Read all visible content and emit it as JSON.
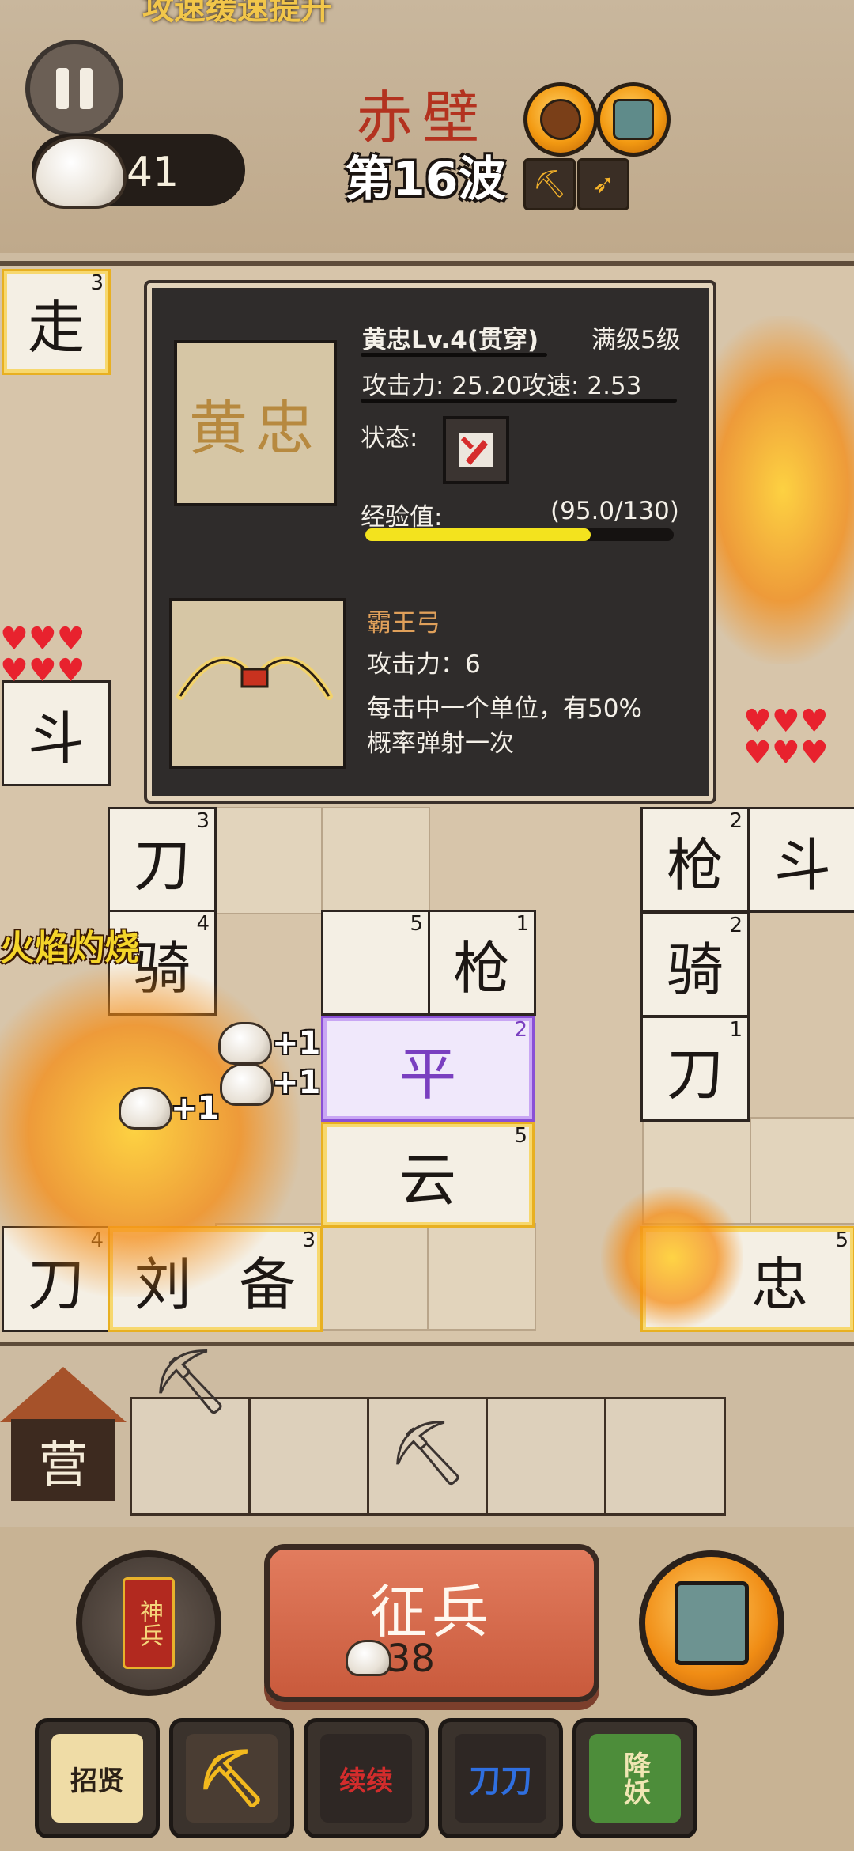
{
  "header": {
    "banner_text": "攻速缓速提升",
    "currency": "41",
    "stage": "赤壁",
    "wave": "第16波"
  },
  "board": {
    "float_texts": [
      "+1",
      "+1",
      "+1"
    ],
    "burn_text": "火焰灼烧",
    "cells": [
      {
        "char": "走",
        "lv": "3"
      },
      {
        "char": "斗",
        "lv": ""
      },
      {
        "char": "斗",
        "lv": ""
      },
      {
        "char": "刀",
        "lv": "3"
      },
      {
        "char": "枪",
        "lv": "2"
      },
      {
        "char": "骑",
        "lv": "2"
      },
      {
        "char": "刀",
        "lv": "1"
      },
      {
        "char": "枪",
        "lv": "1"
      },
      {
        "char": "平",
        "lv": "2"
      },
      {
        "char": "云",
        "lv": "5"
      },
      {
        "char": "刀",
        "lv": "4"
      },
      {
        "char": "刘",
        "lv": ""
      },
      {
        "char": "备",
        "lv": "3"
      },
      {
        "char": "忠",
        "lv": "5"
      },
      {
        "char": "骑",
        "lv": "4"
      }
    ]
  },
  "panel": {
    "portrait": "黄忠",
    "hero_name": "黄忠Lv.4(贯穿)",
    "max_level": "满级5级",
    "stats": "攻击力: 25.20攻速: 2.53",
    "status_label": "状态:",
    "exp_label": "经验值:",
    "exp_value": "(95.0/130)",
    "exp_fraction": 0.731,
    "weapon_name": "霸王弓",
    "weapon_attack": "攻击力：6",
    "weapon_desc_1": "每击中一个单位，有50%",
    "weapon_desc_2": "概率弹射一次"
  },
  "bench": {
    "camp_label": "营"
  },
  "controls": {
    "god_soldier": "神兵",
    "recruit_label": "征兵",
    "recruit_cost": "38"
  },
  "toolbar": {
    "items": [
      {
        "label": "招贤"
      },
      {
        "label": ""
      },
      {
        "label": "续续"
      },
      {
        "label": "刀刀"
      },
      {
        "label": "降妖"
      }
    ]
  }
}
